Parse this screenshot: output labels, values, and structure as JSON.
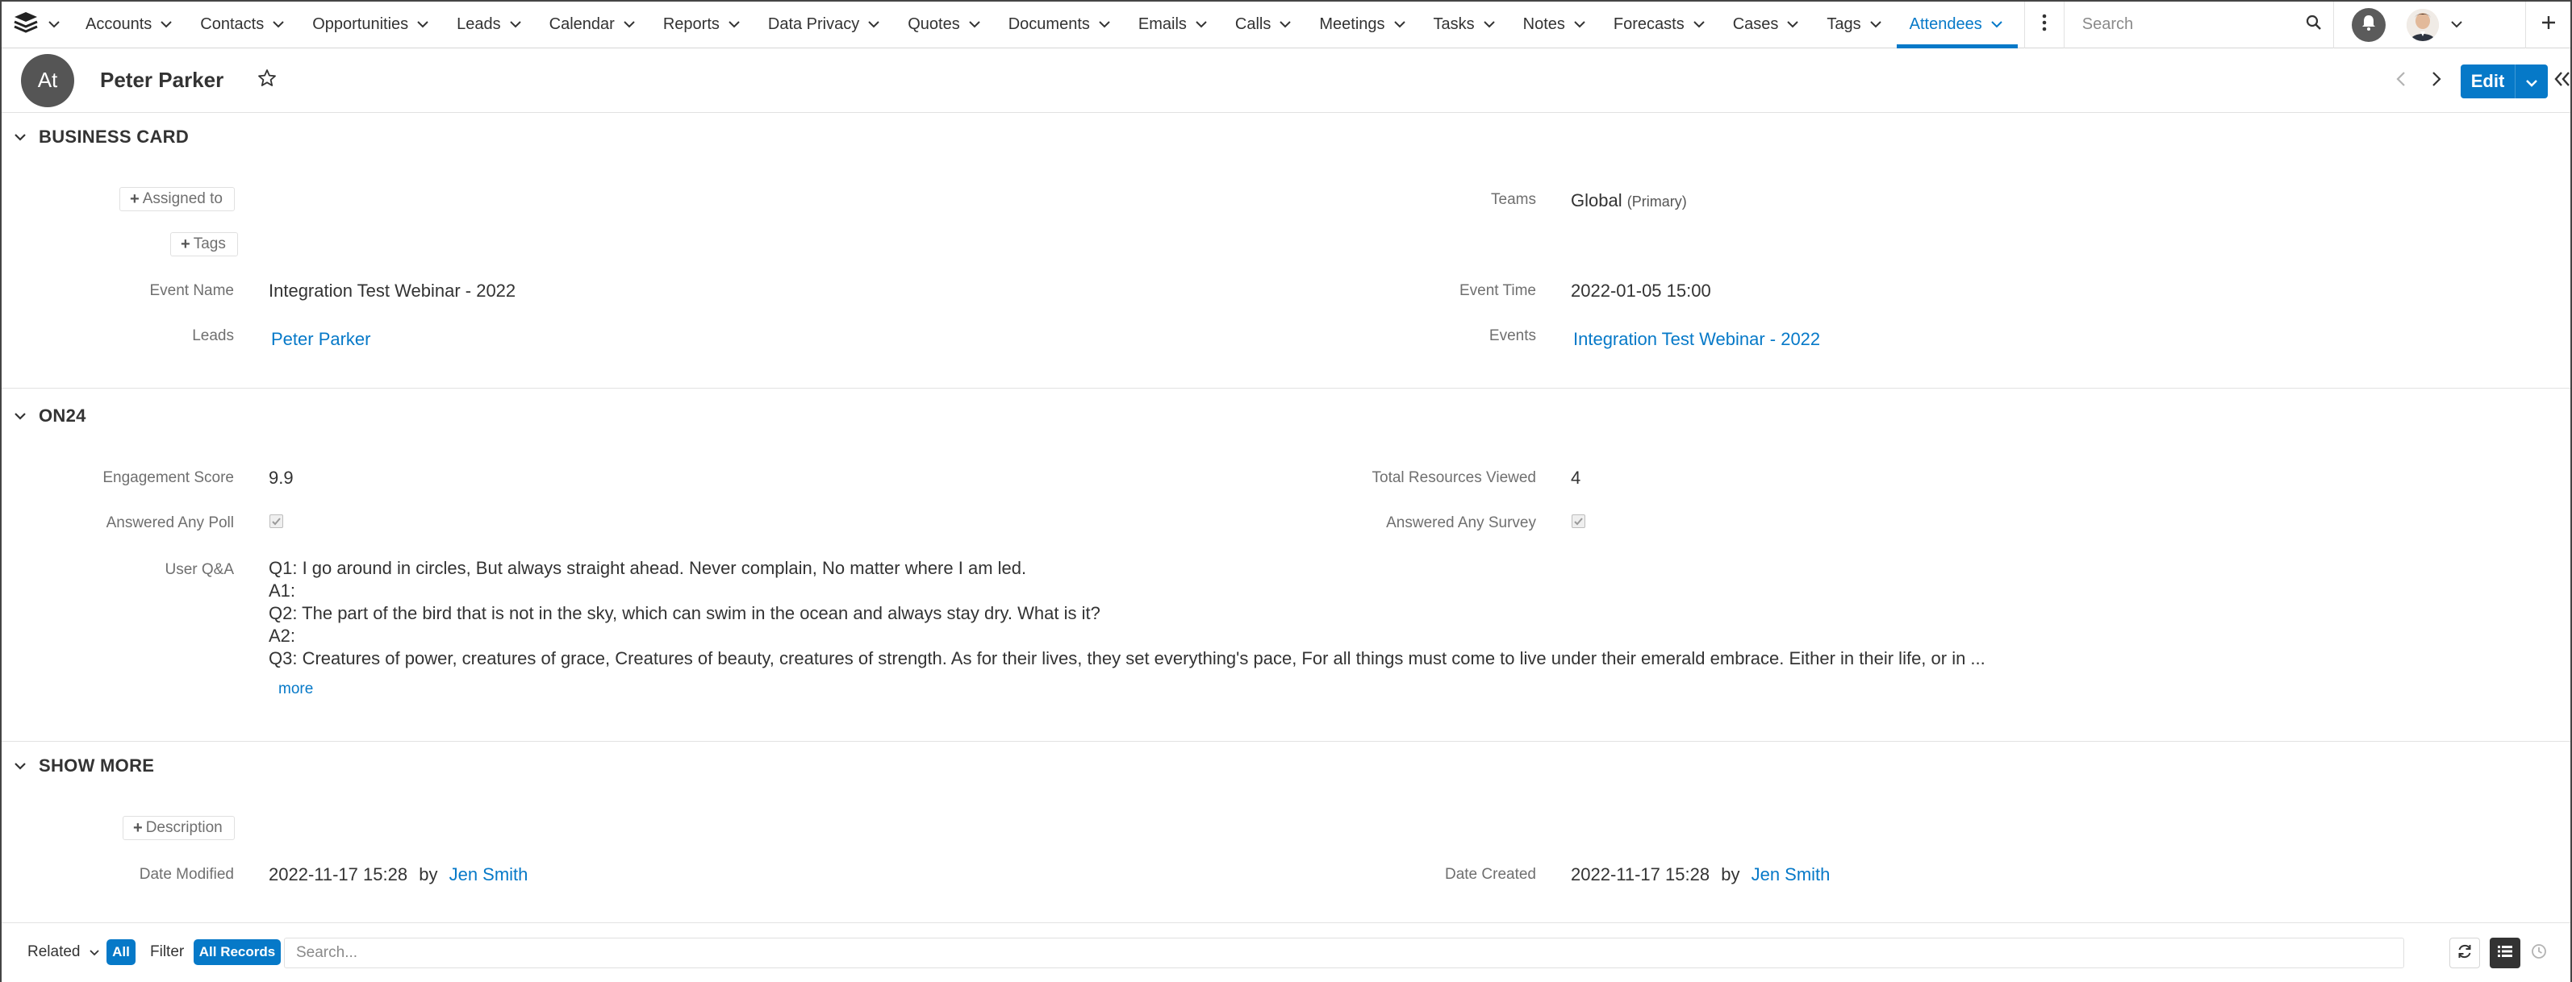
{
  "nav": {
    "items": [
      {
        "label": "Accounts"
      },
      {
        "label": "Contacts"
      },
      {
        "label": "Opportunities"
      },
      {
        "label": "Leads"
      },
      {
        "label": "Calendar"
      },
      {
        "label": "Reports"
      },
      {
        "label": "Data Privacy"
      },
      {
        "label": "Quotes"
      },
      {
        "label": "Documents"
      },
      {
        "label": "Emails"
      },
      {
        "label": "Calls"
      },
      {
        "label": "Meetings"
      },
      {
        "label": "Tasks"
      },
      {
        "label": "Notes"
      },
      {
        "label": "Forecasts"
      },
      {
        "label": "Cases"
      },
      {
        "label": "Tags"
      },
      {
        "label": "Attendees",
        "active": true
      }
    ],
    "search_placeholder": "Search",
    "accent_color": "#0679c8"
  },
  "record": {
    "avatar_initials": "At",
    "name": "Peter Parker",
    "edit_label": "Edit"
  },
  "business_card": {
    "title": "BUSINESS CARD",
    "assigned_to_label": "Assigned to",
    "tags_label": "Tags",
    "teams_label": "Teams",
    "teams_value": "Global",
    "teams_suffix": "(Primary)",
    "event_name_label": "Event Name",
    "event_name_value": "Integration Test Webinar - 2022",
    "event_time_label": "Event Time",
    "event_time_value": "2022-01-05 15:00",
    "leads_label": "Leads",
    "leads_value": "Peter Parker",
    "events_label": "Events",
    "events_value": "Integration Test Webinar - 2022"
  },
  "on24": {
    "title": "ON24",
    "engagement_label": "Engagement Score",
    "engagement_value": "9.9",
    "resources_label": "Total Resources Viewed",
    "resources_value": "4",
    "poll_label": "Answered Any Poll",
    "survey_label": "Answered Any Survey",
    "qa_label": "User Q&A",
    "qa_lines": [
      "Q1: I go around in circles, But always straight ahead. Never complain, No matter where I am led.",
      "A1:",
      "Q2: The part of the bird that is not in the sky, which can swim in the ocean and always stay dry. What is it?",
      "A2:",
      "Q3: Creatures of power, creatures of grace, Creatures of beauty, creatures of strength. As for their lives, they set everything's pace, For all things must come to live under their emerald embrace. Either in their life, or in ..."
    ],
    "more_label": "more"
  },
  "show_more": {
    "title": "SHOW MORE",
    "description_label": "Description",
    "date_modified_label": "Date Modified",
    "date_modified_value": "2022-11-17 15:28",
    "by_label": "by",
    "modified_by": "Jen Smith",
    "date_created_label": "Date Created",
    "date_created_value": "2022-11-17 15:28",
    "created_by": "Jen Smith"
  },
  "footer": {
    "related_label": "Related",
    "all_label": "All",
    "filter_label": "Filter",
    "all_records_label": "All Records",
    "search_placeholder": "Search..."
  }
}
